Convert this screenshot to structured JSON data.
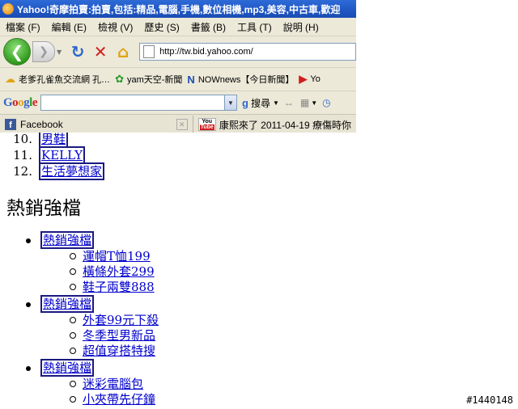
{
  "window": {
    "title": "Yahoo!奇摩拍賣:拍賣,包括:精品,電腦,手機,數位相機,mp3,美容,中古車,歡迎"
  },
  "menu": [
    "檔案 (F)",
    "編輯 (E)",
    "檢視 (V)",
    "歷史 (S)",
    "書籤 (B)",
    "工具 (T)",
    "說明 (H)"
  ],
  "nav": {
    "url": "http://tw.bid.yahoo.com/"
  },
  "bookmarks": [
    {
      "label": "老爹孔雀魚交流網 孔…",
      "icon": "lifebuoy-icon"
    },
    {
      "label": "yam天空-新聞",
      "icon": "yam-icon"
    },
    {
      "label": "NOWnews【今日新聞】",
      "icon": "now-icon"
    },
    {
      "label": "Yo",
      "icon": "youtube-icon"
    }
  ],
  "google": {
    "logo": "Google",
    "search_label": "搜尋"
  },
  "tabs": [
    {
      "label": "Facebook"
    },
    {
      "label": "康熙來了 2011-04-19 療傷時你"
    }
  ],
  "numbered_list": [
    {
      "num": "10.",
      "label": "男鞋"
    },
    {
      "num": "11.",
      "label": "KELLY"
    },
    {
      "num": "12.",
      "label": "生活夢想家"
    }
  ],
  "section_title": "熱銷強檔",
  "sections": [
    {
      "label": "熱銷強檔",
      "items": [
        "運帽T恤199",
        "橫條外套299",
        "鞋子兩雙888"
      ]
    },
    {
      "label": "熱銷強檔",
      "items": [
        "外套99元下殺",
        "冬季型男新品",
        "超值穿搭特搜"
      ]
    },
    {
      "label": "熱銷強檔",
      "items": [
        "迷彩電腦包",
        "小夾帶先仔鐘"
      ]
    }
  ],
  "watermark": "#1440148"
}
